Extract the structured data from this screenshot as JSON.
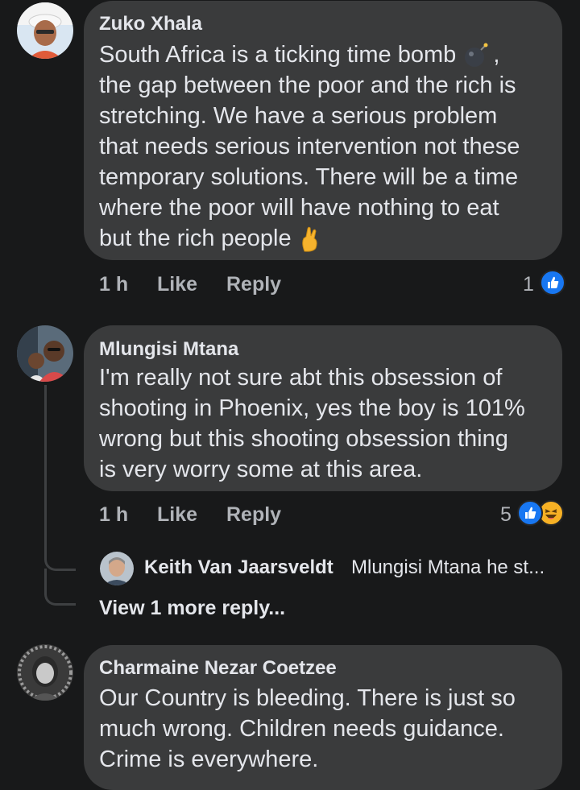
{
  "comments": [
    {
      "author": "Zuko Xhala",
      "lines": [
        "South Africa is a ticking time bomb",
        "the gap between the poor and the rich is",
        "stretching. We have a serious problem",
        "that needs serious intervention not these",
        "temporary solutions. There will be a time",
        "where the poor will have nothing to eat",
        "but the rich people"
      ],
      "inline_emoji": [
        "bomb-emoji",
        "crossed-fingers-emoji"
      ],
      "time": "1 h",
      "like_label": "Like",
      "reply_label": "Reply",
      "reaction_count": "1",
      "reactions": [
        "like-icon"
      ]
    },
    {
      "author": "Mlungisi Mtana",
      "lines": [
        "I'm really not sure abt this obsession of",
        "shooting in Phoenix, yes the boy is 101%",
        "wrong but this shooting obsession thing",
        "is very worry some at this area."
      ],
      "time": "1 h",
      "like_label": "Like",
      "reply_label": "Reply",
      "reaction_count": "5",
      "reactions": [
        "like-icon",
        "haha-icon"
      ],
      "reply_preview": {
        "author": "Keith Van Jaarsveldt",
        "text": "Mlungisi Mtana he st..."
      },
      "view_more": "View 1 more reply..."
    },
    {
      "author": "Charmaine Nezar Coetzee",
      "lines": [
        "Our Country is bleeding. There is just so",
        "much wrong. Children needs guidance.",
        "Crime is everywhere."
      ]
    }
  ],
  "colors": {
    "background": "#18191a",
    "bubble": "#3a3b3c",
    "text": "#e4e6eb",
    "secondary_text": "#b0b3b8",
    "like_blue": "#1877f2",
    "haha_yellow": "#f7b125"
  }
}
